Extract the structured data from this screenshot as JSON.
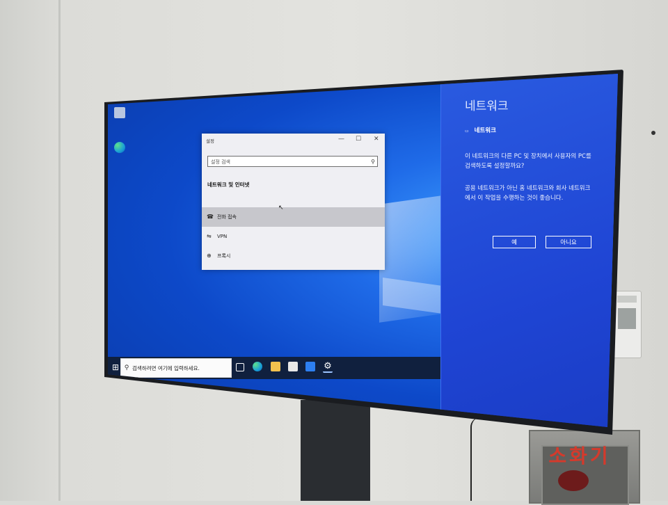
{
  "settings_window": {
    "title": "설정",
    "controls": {
      "minimize": "—",
      "maximize": "☐",
      "close": "✕"
    },
    "search_placeholder": "설정 검색",
    "section_header": "네트워크 및 인터넷",
    "items": [
      {
        "label": "전화 접속",
        "icon": "dialup-icon",
        "selected": true
      },
      {
        "label": "VPN",
        "icon": "vpn-icon",
        "selected": false
      },
      {
        "label": "프록시",
        "icon": "globe-icon",
        "selected": false
      }
    ]
  },
  "network_flyout": {
    "title": "네트워크",
    "network_name": "네트워크",
    "question": "이 네트워크의 다른 PC 및 장치에서 사용자의 PC를 검색하도록 설정할까요?",
    "recommendation": "공용 네트워크가 아닌 홈 네트워크와 회사 네트워크에서 이 작업을 수행하는 것이 좋습니다.",
    "yes_label": "예",
    "no_label": "아니요"
  },
  "taskbar": {
    "search_placeholder": "검색하려면 여기에 입력하세요.",
    "pinned": [
      "task-view-icon",
      "edge-icon",
      "file-explorer-icon",
      "store-icon",
      "mail-icon",
      "settings-icon"
    ]
  },
  "physical": {
    "extinguisher_sign": "소화기"
  },
  "colors": {
    "desktop_blue": "#0d49c9",
    "flyout_blue": "#1f45d4",
    "taskbar": "#10203e"
  }
}
